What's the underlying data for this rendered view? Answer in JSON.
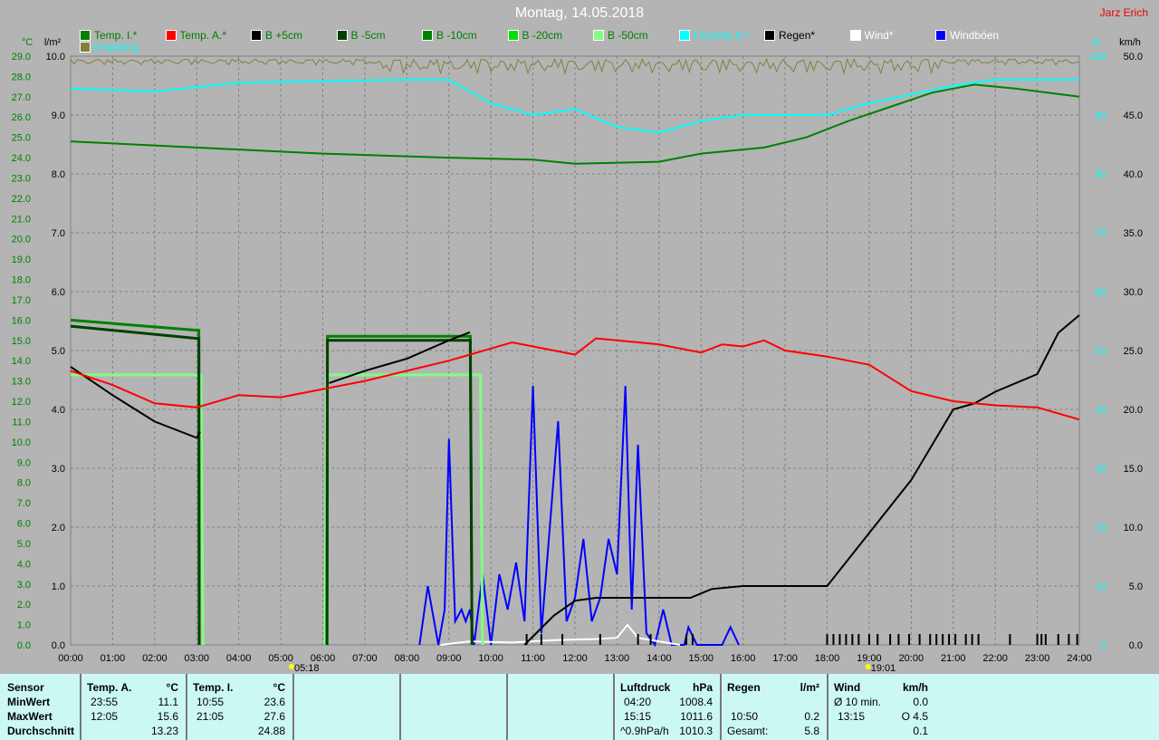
{
  "title": "Montag, 14.05.2018",
  "author": "Jarz Erich",
  "legend": [
    {
      "label": "Temp. I.*",
      "color": "#008000",
      "text": "#008000"
    },
    {
      "label": "Temp. A.*",
      "color": "#ff0000",
      "text": "#008000"
    },
    {
      "label": "B +5cm",
      "color": "#000000",
      "text": "#008000"
    },
    {
      "label": "B -5cm",
      "color": "#004000",
      "text": "#008000"
    },
    {
      "label": "B -10cm",
      "color": "#008000",
      "text": "#008000"
    },
    {
      "label": "B -20cm",
      "color": "#00e000",
      "text": "#008000"
    },
    {
      "label": "B -50cm",
      "color": "#80ff80",
      "text": "#008000"
    },
    {
      "label": "Feuchte A.*",
      "color": "#00ffff",
      "text": "#00ffff"
    },
    {
      "label": "Regen*",
      "color": "#000000",
      "text": "#000000"
    },
    {
      "label": "Wind*",
      "color": "#ffffff",
      "text": "#ffffff"
    },
    {
      "label": "Windböen",
      "color": "#0000ff",
      "text": "#ffffff"
    },
    {
      "label": "Empfang",
      "color": "#808040",
      "text": "#00ffff"
    }
  ],
  "axes": {
    "left1_unit": "°C",
    "left2_unit": "l/m²",
    "right1_unit": "%",
    "right2_unit": "km/h"
  },
  "sun": {
    "rise": "05:18",
    "set": "19:01"
  },
  "chart_data": {
    "type": "line",
    "xlabel": "",
    "xlim": [
      0,
      24
    ],
    "xticks": [
      "00:00",
      "01:00",
      "02:00",
      "03:00",
      "04:00",
      "05:00",
      "06:00",
      "07:00",
      "08:00",
      "09:00",
      "10:00",
      "11:00",
      "12:00",
      "13:00",
      "14:00",
      "15:00",
      "16:00",
      "17:00",
      "18:00",
      "19:00",
      "20:00",
      "21:00",
      "22:00",
      "23:00",
      "24:00"
    ],
    "ylim_temp": [
      0,
      29
    ],
    "ylim_rain": [
      0,
      10
    ],
    "ylim_hum": [
      0,
      100
    ],
    "ylim_wind": [
      0,
      50
    ],
    "series": [
      {
        "name": "Temp. I.*",
        "axis": "temp",
        "color": "#008000",
        "x": [
          0,
          3,
          6,
          9,
          11,
          12,
          14,
          15,
          16.5,
          17.5,
          18.5,
          19.5,
          20.5,
          21.5,
          22.5,
          24
        ],
        "y": [
          24.8,
          24.5,
          24.2,
          24.0,
          23.9,
          23.7,
          23.8,
          24.2,
          24.5,
          25.0,
          25.8,
          26.5,
          27.2,
          27.6,
          27.4,
          27.0
        ]
      },
      {
        "name": "Temp. A.*",
        "axis": "temp",
        "color": "#ff0000",
        "x": [
          0,
          1,
          2,
          3,
          4,
          5,
          6,
          7,
          8,
          9,
          10,
          10.5,
          11.5,
          12,
          12.5,
          13,
          14,
          15,
          15.5,
          16,
          16.5,
          17,
          18,
          19,
          20,
          21,
          22,
          23,
          24
        ],
        "y": [
          13.5,
          12.8,
          11.9,
          11.7,
          12.3,
          12.2,
          12.6,
          13.0,
          13.5,
          14.0,
          14.6,
          14.9,
          14.5,
          14.3,
          15.1,
          15.0,
          14.8,
          14.4,
          14.8,
          14.7,
          15.0,
          14.5,
          14.2,
          13.8,
          12.5,
          12.0,
          11.8,
          11.7,
          11.1
        ]
      },
      {
        "name": "B +5cm",
        "axis": "temp",
        "color": "#000000",
        "x": [
          0,
          1,
          2,
          3,
          3.08,
          null,
          6.15,
          7,
          8,
          9,
          9.5
        ],
        "y": [
          13.7,
          12.3,
          11.0,
          10.2,
          10.5,
          null,
          12.9,
          13.5,
          14.1,
          15.0,
          15.4
        ]
      },
      {
        "name": "B -5cm",
        "axis": "temp",
        "color": "#004000",
        "x": [
          0,
          3,
          3.05,
          3.06,
          null,
          6.1,
          6.11,
          9.5,
          9.51,
          9.55
        ],
        "y": [
          15.7,
          15.1,
          15.1,
          0,
          null,
          0,
          15.0,
          15.0,
          15.0,
          0
        ]
      },
      {
        "name": "B -10cm",
        "axis": "temp",
        "color": "#008000",
        "x": [
          0,
          3,
          3.05,
          3.06,
          null,
          6.1,
          6.11,
          9.5,
          9.51,
          9.55
        ],
        "y": [
          16.0,
          15.5,
          15.5,
          0,
          null,
          0,
          15.2,
          15.2,
          15.2,
          0
        ]
      },
      {
        "name": "B -50cm",
        "axis": "temp",
        "color": "#80ff80",
        "x": [
          0,
          3,
          3.1,
          3.15,
          null,
          6.05,
          6.1,
          9.7,
          9.75,
          9.8
        ],
        "y": [
          13.3,
          13.3,
          13.3,
          0,
          null,
          0,
          13.3,
          13.3,
          13.3,
          0
        ]
      },
      {
        "name": "Feuchte A.*",
        "axis": "hum",
        "color": "#00ffff",
        "x": [
          0,
          2,
          4,
          8,
          9,
          10,
          11,
          12,
          13,
          14,
          15,
          16,
          18,
          19,
          21,
          22,
          24
        ],
        "y": [
          94.5,
          94,
          95.5,
          96,
          96,
          92,
          90,
          91,
          88,
          87,
          89,
          90,
          90,
          92,
          95,
          96,
          96
        ]
      },
      {
        "name": "Regen*",
        "axis": "rain",
        "color": "#000000",
        "x": [
          10.8,
          11.5,
          12,
          12.5,
          14.75,
          15.25,
          16,
          18,
          19,
          20,
          21,
          21.5,
          22,
          23,
          23.5,
          24
        ],
        "y": [
          0,
          0.5,
          0.75,
          0.8,
          0.8,
          0.95,
          1.0,
          1.0,
          1.9,
          2.8,
          4.0,
          4.1,
          4.3,
          4.6,
          5.3,
          5.6
        ]
      },
      {
        "name": "Wind*",
        "axis": "wind",
        "color": "#ffffff",
        "x": [
          8.8,
          9.5,
          10.5,
          11.5,
          12.5,
          13,
          13.25,
          13.5,
          14,
          14.5
        ],
        "y": [
          0,
          0.3,
          0.2,
          0.4,
          0.5,
          0.6,
          1.7,
          0.6,
          0.3,
          0
        ]
      },
      {
        "name": "Windböen",
        "axis": "wind",
        "color": "#0000ff",
        "x": [
          8.3,
          8.5,
          8.75,
          8.9,
          9.0,
          9.15,
          9.3,
          9.4,
          9.5,
          9.6,
          9.8,
          10.0,
          10.2,
          10.4,
          10.6,
          10.8,
          11.0,
          11.2,
          11.4,
          11.6,
          11.8,
          12.0,
          12.2,
          12.4,
          12.6,
          12.8,
          13.0,
          13.2,
          13.35,
          13.5,
          13.7,
          13.9,
          14.1,
          14.3,
          14.6,
          14.7,
          14.9,
          15.5,
          15.7,
          15.9
        ],
        "y": [
          0,
          5,
          0,
          3,
          17.5,
          2,
          3,
          2,
          3,
          0,
          6,
          0,
          6,
          3,
          7,
          2,
          22,
          1,
          10,
          19,
          2,
          4,
          9,
          2,
          4,
          9,
          6,
          22,
          3,
          17,
          1,
          0,
          3,
          0,
          0,
          1.5,
          0,
          0,
          1.5,
          0
        ]
      },
      {
        "name": "Empfang",
        "axis": "hum",
        "color": "#808040",
        "x": [
          0,
          24
        ],
        "y": [
          99,
          99
        ]
      }
    ],
    "rain_ticks": [
      10.85,
      11.2,
      11.7,
      12.6,
      13.5,
      13.8,
      14.65,
      14.8,
      18.0,
      18.15,
      18.3,
      18.45,
      18.6,
      18.75,
      19.0,
      19.2,
      19.5,
      19.7,
      19.95,
      20.2,
      20.45,
      20.6,
      20.75,
      20.9,
      21.05,
      21.3,
      21.45,
      21.6,
      22.35,
      23.0,
      23.1,
      23.2,
      23.5,
      23.75,
      23.95
    ]
  },
  "stats": {
    "sensor": "Sensor",
    "min": "MinWert",
    "max": "MaxWert",
    "avg": "Durchschnitt",
    "ta": {
      "h": "Temp. A.",
      "u": "°C",
      "min_t": "23:55",
      "min_v": "11.1",
      "max_t": "12:05",
      "max_v": "15.6",
      "avg": "13.23"
    },
    "ti": {
      "h": "Temp. I.",
      "u": "°C",
      "min_t": "10:55",
      "min_v": "23.6",
      "max_t": "21:05",
      "max_v": "27.6",
      "avg": "24.88"
    },
    "lp": {
      "h": "Luftdruck",
      "u": "hPa",
      "min_t": "04:20",
      "min_v": "1008.4",
      "max_t": "15:15",
      "max_v": "1011.6",
      "trend": "^0.9hPa/h",
      "avg": "1010.3"
    },
    "rg": {
      "h": "Regen",
      "u": "l/m²",
      "max_t": "10:50",
      "max_v": "0.2",
      "tot_l": "Gesamt:",
      "tot_v": "5.8"
    },
    "wd": {
      "h": "Wind",
      "u": "km/h",
      "avg_l": "Ø 10 min.",
      "avg_v": "0.0",
      "max_t": "13:15",
      "max_v": "O 4.5",
      "mean": "0.1"
    }
  }
}
